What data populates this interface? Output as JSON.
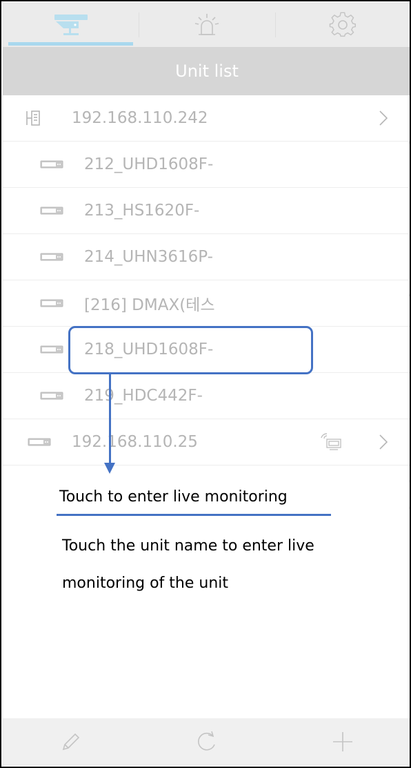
{
  "header": {
    "tabs": [
      {
        "icon": "camera-icon",
        "active": true
      },
      {
        "icon": "alarm-icon",
        "active": false
      },
      {
        "icon": "gear-icon",
        "active": false
      }
    ],
    "title": "Unit list"
  },
  "units": [
    {
      "icon": "server-icon",
      "label": "192.168.110.242",
      "chevron": true,
      "level": 0
    },
    {
      "icon": "device-icon",
      "label": "212_UHD1608F-",
      "level": 1
    },
    {
      "icon": "device-icon",
      "label": "213_HS1620F-",
      "level": 1
    },
    {
      "icon": "device-icon",
      "label": "214_UHN3616P-",
      "level": 1
    },
    {
      "icon": "device-icon",
      "label": "[216] DMAX(테스",
      "level": 1
    },
    {
      "icon": "device-icon",
      "label": "218_UHD1608F-",
      "level": 1
    },
    {
      "icon": "device-icon",
      "label": "219_HDC442F-",
      "level": 1
    },
    {
      "icon": "device-icon",
      "label": "192.168.110.25",
      "chevron": true,
      "wireless": true,
      "level": 0
    }
  ],
  "callout": {
    "title": "Touch to enter live monitoring",
    "description": "Touch the unit name to enter live monitoring of the unit"
  },
  "toolbar": {
    "buttons": [
      "edit-icon",
      "refresh-icon",
      "add-icon"
    ]
  },
  "colors": {
    "accent": "#a9d8ee",
    "callout": "#4472c4",
    "header_bg": "#d6d6d6",
    "text_muted": "#b5b5b5"
  }
}
